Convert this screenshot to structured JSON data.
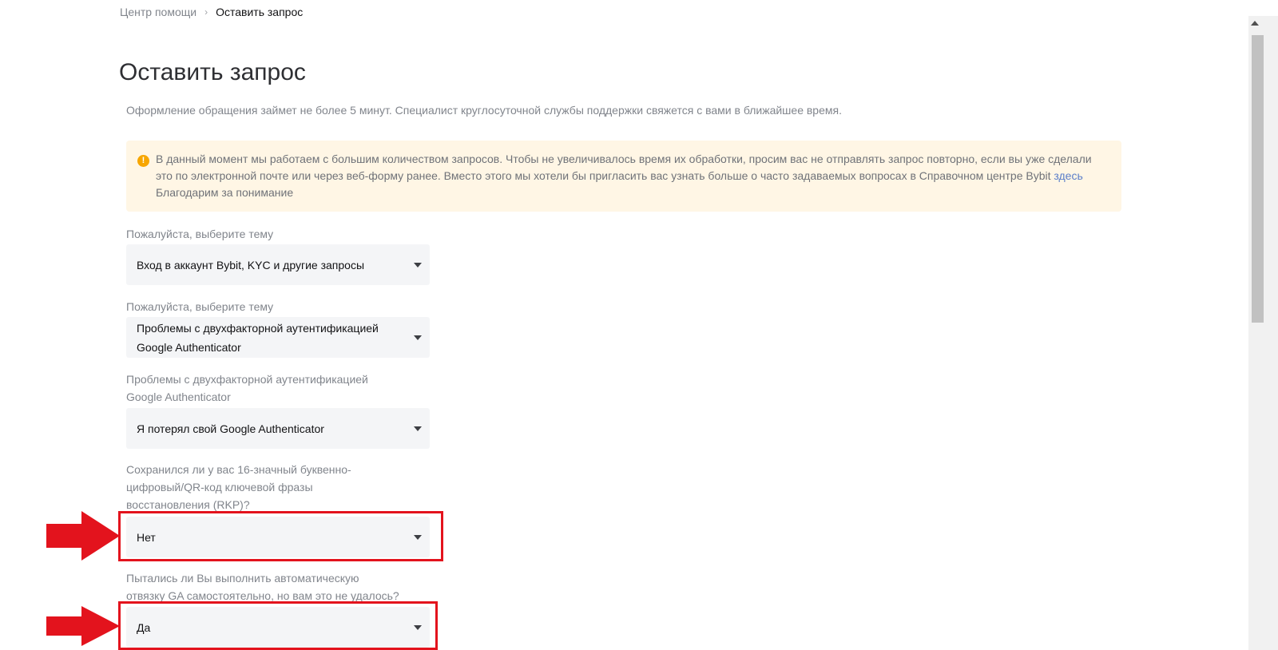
{
  "breadcrumb": {
    "home": "Центр помощи",
    "current": "Оставить запрос"
  },
  "page": {
    "title": "Оставить запрос",
    "subtitle": "Оформление обращения займет не более 5 минут. Специалист круглосуточной службы поддержки свяжется с вами в ближайшее время."
  },
  "notice": {
    "icon": "info-icon",
    "line1": "В данный момент мы работаем с большим количеством запросов. Чтобы не увеличивалось время их обработки, просим вас не отправлять запрос повторно, если вы уже сделали",
    "line2": "это по электронной почте или через веб-форму ранее. Вместо этого мы хотели бы пригласить вас узнать больше о часто задаваемых вопросах в Справочном центре Bybit",
    "link": "здесь",
    "line3": "Благодарим за понимание",
    "colors": {
      "background": "#fff6e5",
      "icon": "#f7a600",
      "link": "#5b7ec9"
    }
  },
  "form": {
    "field1": {
      "label": "Пожалуйста, выберите тему",
      "value": "Вход в аккаунт Bybit, KYC и другие запросы"
    },
    "field2": {
      "label": "Пожалуйста, выберите тему",
      "value_line1": "Проблемы с двухфакторной аутентификацией",
      "value_line2": "Google Authenticator"
    },
    "field3": {
      "label_line1": "Проблемы с двухфакторной аутентификацией",
      "label_line2": "Google Authenticator",
      "value": "Я потерял свой Google Authenticator"
    },
    "field4": {
      "label_line1": "Сохранился ли у вас 16-значный буквенно-",
      "label_line2": "цифровый/QR-код ключевой фразы",
      "label_line3": "восстановления (RKP)?",
      "value": "Нет"
    },
    "field5": {
      "label_line1": "Пытались ли Вы выполнить автоматическую",
      "label_line2": "отвязку GA самостоятельно, но вам это не удалось?",
      "value": "Да"
    }
  },
  "annotations": {
    "highlight_color": "#e3131d"
  }
}
